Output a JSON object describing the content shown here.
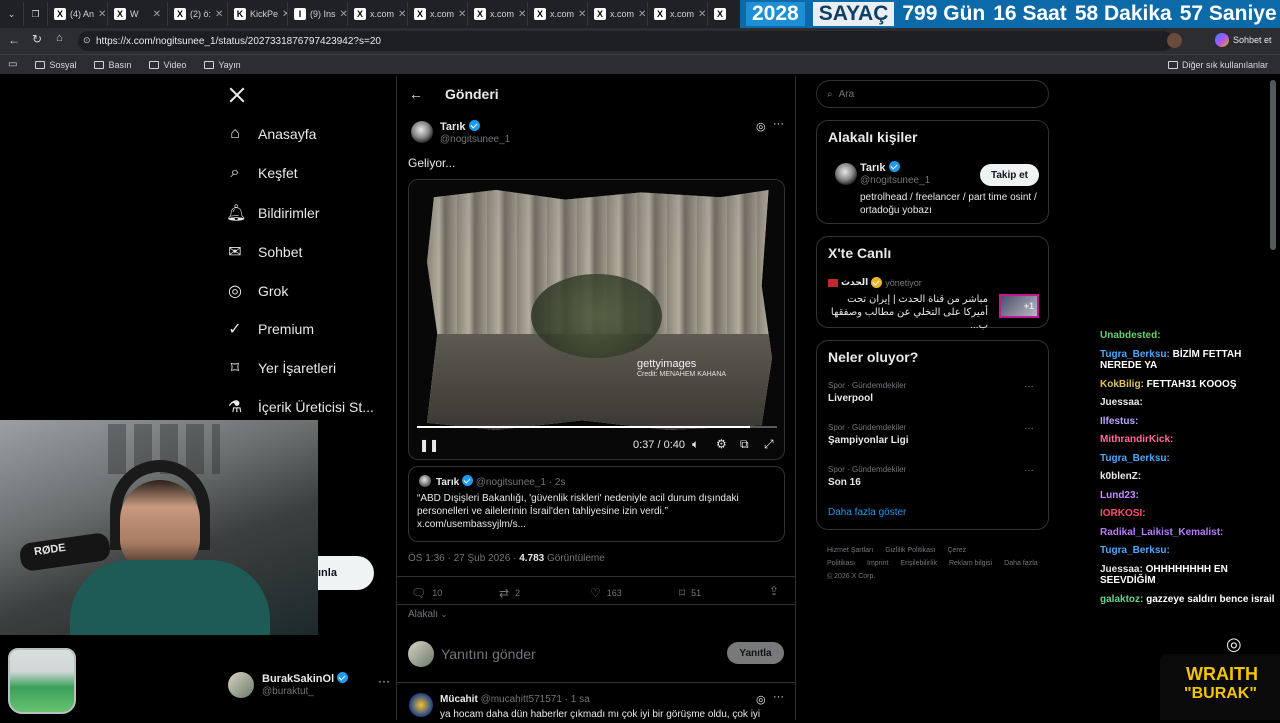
{
  "browser": {
    "tabs": [
      {
        "icon": "X",
        "label": "(4) An"
      },
      {
        "icon": "X",
        "label": "W"
      },
      {
        "icon": "X",
        "label": "(2) ö:"
      },
      {
        "icon": "K",
        "label": "KickPe"
      },
      {
        "icon": "I",
        "label": "(9) Ins"
      },
      {
        "icon": "X",
        "label": "x.com"
      },
      {
        "icon": "X",
        "label": "x.com"
      },
      {
        "icon": "X",
        "label": "x.com"
      },
      {
        "icon": "X",
        "label": "x.com"
      },
      {
        "icon": "X",
        "label": "x.com"
      },
      {
        "icon": "X",
        "label": "x.com"
      },
      {
        "icon": "X",
        "label": ""
      }
    ],
    "url": "https://x.com/nogitsunee_1/status/2027331876797423942?s=20",
    "bookmarks": [
      "Sosyal",
      "Basın",
      "Video",
      "Yayın"
    ],
    "other_bookmarks": "Diğer sık kullanılanlar",
    "profile_label": "Sohbet et"
  },
  "countdown": {
    "year": "2028",
    "label": "SAYAÇ",
    "days": "799 Gün",
    "hours": "16 Saat",
    "minutes": "58 Dakika",
    "seconds": "57 Saniye"
  },
  "nav": {
    "items": [
      {
        "label": "Anasayfa",
        "icon": "home-icon"
      },
      {
        "label": "Keşfet",
        "icon": "search-icon"
      },
      {
        "label": "Bildirimler",
        "icon": "bell-icon"
      },
      {
        "label": "Sohbet",
        "icon": "mail-icon"
      },
      {
        "label": "Grok",
        "icon": "grok-icon"
      },
      {
        "label": "Premium",
        "icon": "premium-icon"
      },
      {
        "label": "Yer İşaretleri",
        "icon": "bookmark-icon"
      },
      {
        "label": "İçerik Üreticisi St...",
        "icon": "flask-icon"
      }
    ],
    "post_button": "ınla",
    "account_name": "BurakSakinOl",
    "account_handle": "@buraktut_"
  },
  "post": {
    "header_title": "Gönderi",
    "author_name": "Tarık",
    "author_handle": "@nogitsunee_1",
    "text": "Geliyor...",
    "video": {
      "time": "0:37 / 0:40",
      "progress": 0.925,
      "watermark": "gettyimages",
      "credit": "Credit: MENAHEM KAHANA"
    },
    "quote": {
      "author_name": "Tarık",
      "author_handle": "@nogitsunee_1 · 2s",
      "text": "“ABD Dışişleri Bakanlığı, 'güvenlik riskleri' nedeniyle acil durum dışındaki personelleri ve ailelerinin İsrail'den tahliyesine izin verdi.” x.com/usembassyjlm/s..."
    },
    "meta_time": "ÖS 1:36 · 27 Şub 2026 · ",
    "meta_views": "4.783",
    "meta_views_label": " Görüntüleme",
    "stats": {
      "replies": "10",
      "reposts": "2",
      "likes": "163",
      "bookmarks": "51"
    },
    "relevance": "Alakalı",
    "reply_placeholder": "Yanıtını gönder",
    "reply_button": "Yanıtla",
    "next_reply": {
      "name": "Mücahit",
      "handle": "@mucahitt571571 · 1 sa",
      "text": "ya hocam daha dün haberler çıkmadı mı çok iyi bir görüşme oldu, çok iyi"
    }
  },
  "sidebar": {
    "search_placeholder": "Ara",
    "related_title": "Alakalı kişiler",
    "related_name": "Tarık",
    "related_handle": "@nogitsunee_1",
    "related_bio": "petrolhead / freelancer / part time osint / ortadoğu yobazı",
    "follow_button": "Takip et",
    "live_title": "X'te Canlı",
    "live_host": "الحدث",
    "live_status": "yönetiyor",
    "live_text": "مباشر من قناة الحدث | إيران تحت أميركا على التخلي عن مطالب وصفقها ب...",
    "live_badge": "+1",
    "trends_title": "Neler oluyor?",
    "trends": [
      {
        "category": "Spor · Gündemdekiler",
        "name": "Liverpool"
      },
      {
        "category": "Spor · Gündemdekiler",
        "name": "Şampiyonlar Ligi"
      },
      {
        "category": "Spor · Gündemdekiler",
        "name": "Son 16"
      }
    ],
    "show_more": "Daha fazla göster",
    "footer_links": [
      "Hizmet Şartları",
      "Gizlilik Politikası",
      "Çerez Politikası",
      "Imprint",
      "Erişilebilirlik",
      "Reklam bilgisi",
      "Daha fazla ..."
    ],
    "copyright": "© 2026 X Corp."
  },
  "stream": {
    "mic_brand": "RØDE",
    "chat": [
      {
        "user": "Unabdested:",
        "color": "#62d36a",
        "msg": ""
      },
      {
        "user": "Tugra_Berksu:",
        "color": "#4aa8ff",
        "msg": "BİZİM FETTAH NEREDE YA"
      },
      {
        "user": "KokBilig:",
        "color": "#e0c15a",
        "msg": "FETTAH31 KOOOŞ"
      },
      {
        "user": "Juessaa:",
        "color": "#e8e8e8",
        "msg": ""
      },
      {
        "user": "Ilfestus:",
        "color": "#bda3ff",
        "msg": ""
      },
      {
        "user": "MithrandirKick:",
        "color": "#ff6a9b",
        "msg": ""
      },
      {
        "user": "Tugra_Berksu:",
        "color": "#4aa8ff",
        "msg": ""
      },
      {
        "user": "k0blenZ:",
        "color": "#e8e8e8",
        "msg": ""
      },
      {
        "user": "Lund23:",
        "color": "#c88cff",
        "msg": ""
      },
      {
        "user": "IORKOSI:",
        "color": "#ff4d6d",
        "msg": ""
      },
      {
        "user": "Radikal_Laikist_Kemalist:",
        "color": "#b57bff",
        "msg": ""
      },
      {
        "user": "Tugra_Berksu:",
        "color": "#4aa8ff",
        "msg": ""
      },
      {
        "user": "Juessaa:",
        "color": "#e8e8e8",
        "msg": "OHHHHHHHH EN SEEVDİĞİM"
      },
      {
        "user": "galaktoz:",
        "color": "#6bd38f",
        "msg": "gazzeye saldırı bence israil"
      }
    ],
    "overlay_title": "WRAITH",
    "overlay_sub": "\"BURAK\""
  }
}
